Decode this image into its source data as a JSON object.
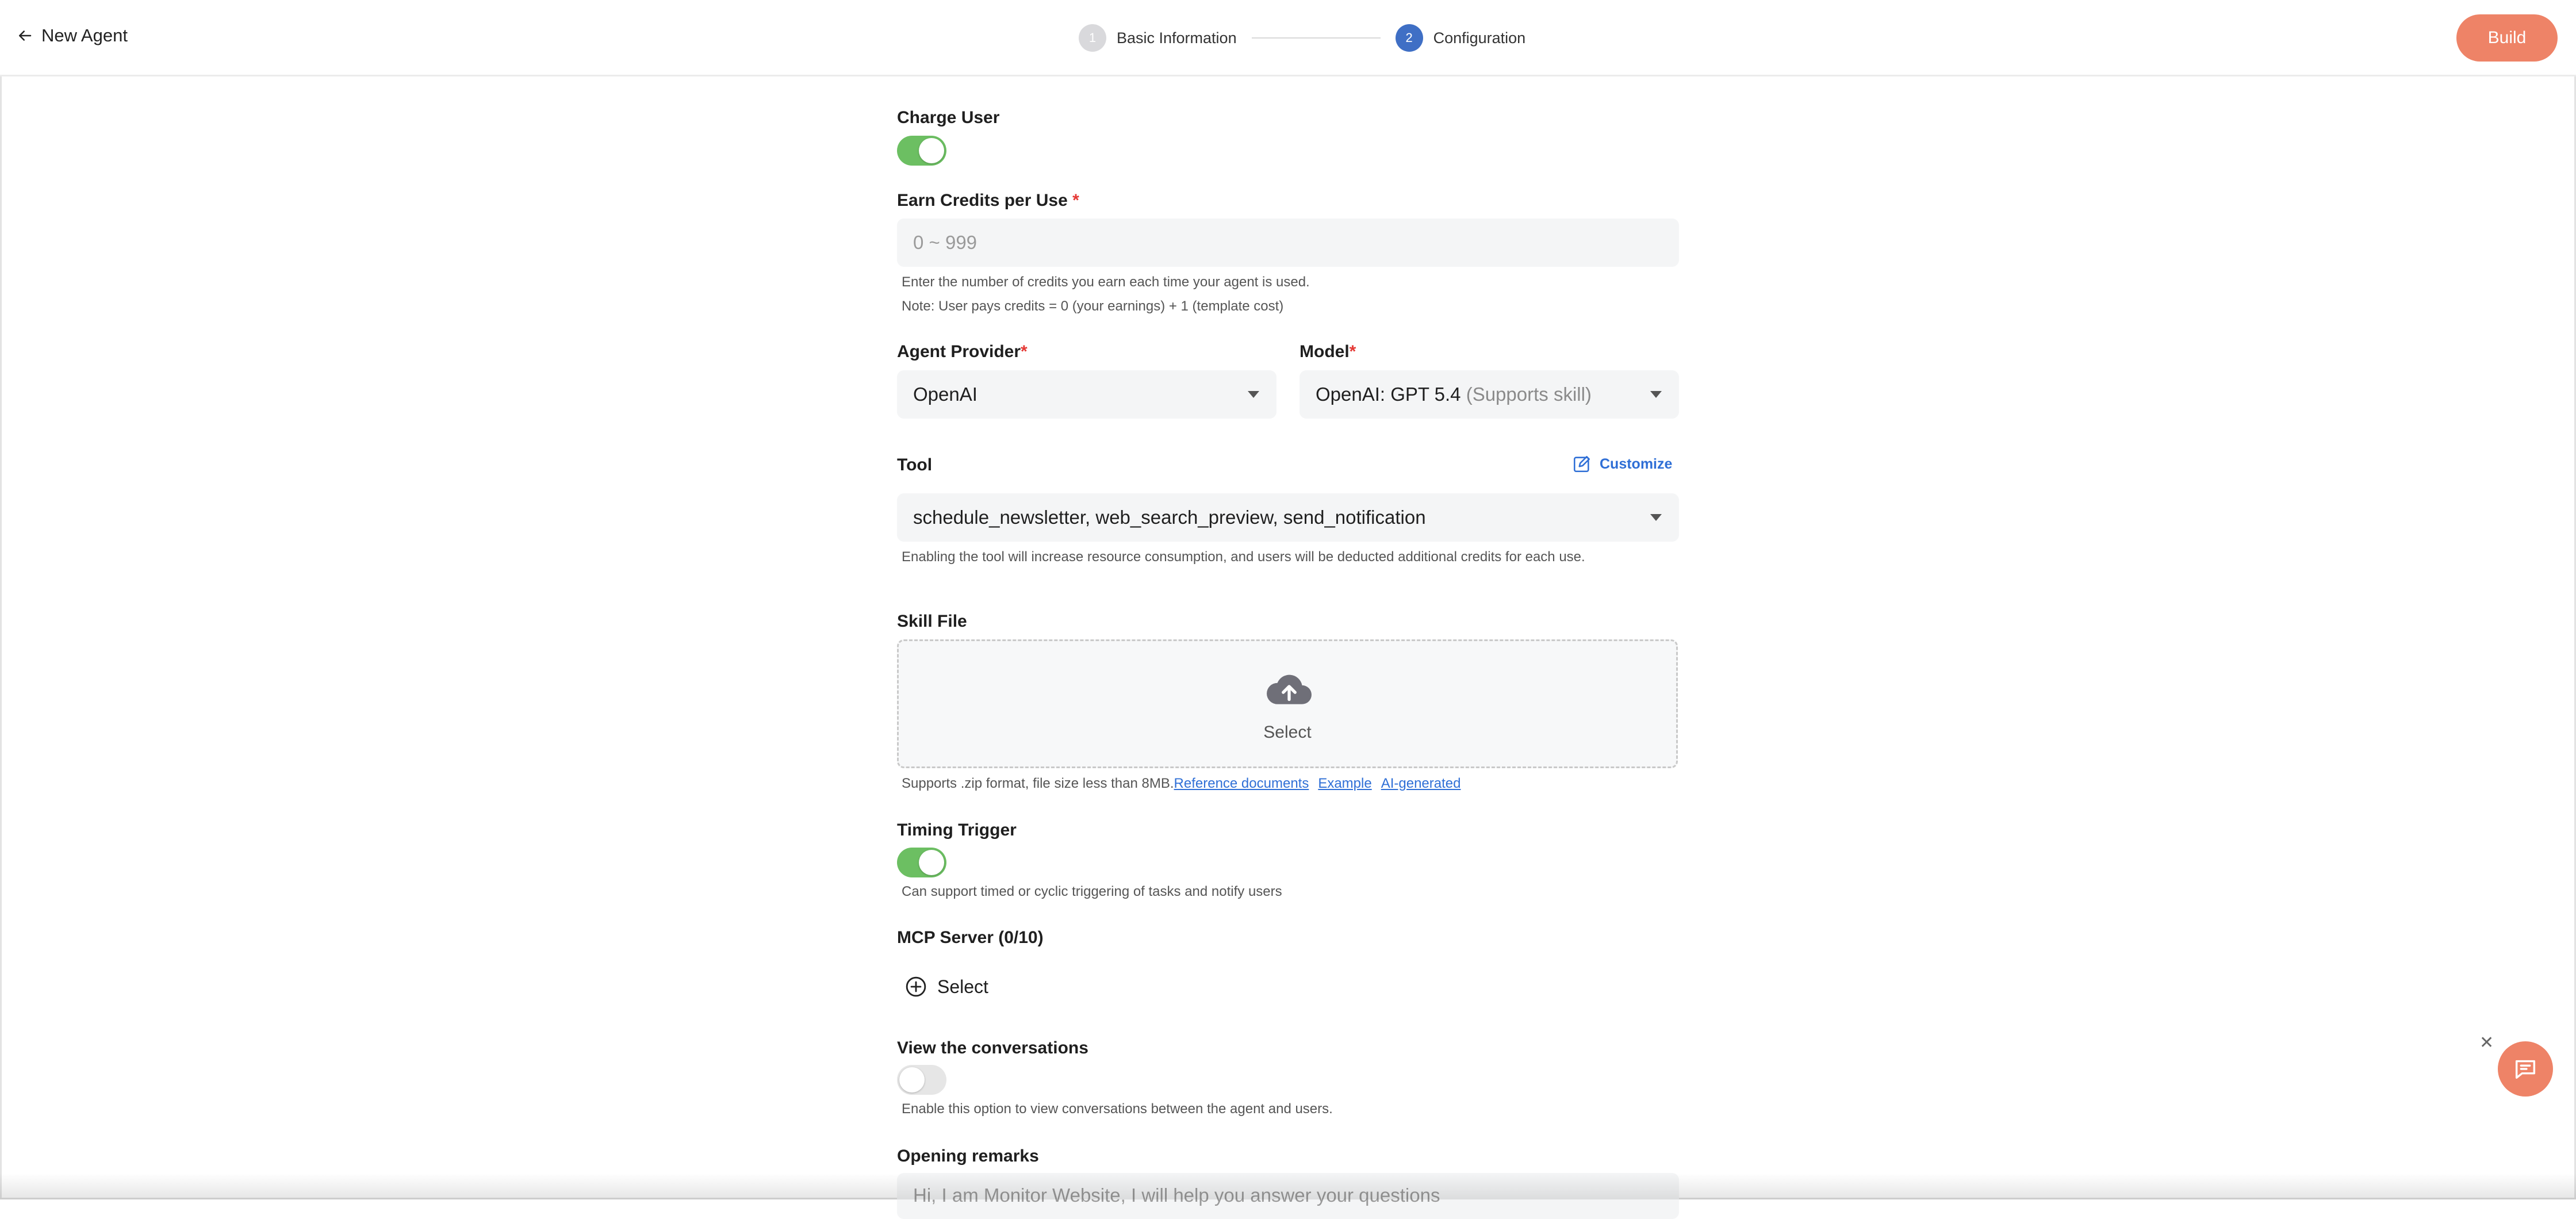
{
  "header": {
    "back_label": "New Agent",
    "steps": [
      {
        "num": "1",
        "label": "Basic Information"
      },
      {
        "num": "2",
        "label": "Configuration"
      }
    ],
    "build_label": "Build"
  },
  "charge_user": {
    "label": "Charge User",
    "enabled": true
  },
  "earn_credits": {
    "label": "Earn Credits per Use",
    "required_mark": "*",
    "placeholder": "0 ~ 999",
    "help1": "Enter the number of credits you earn each time your agent is used.",
    "help2": "Note: User pays credits = 0 (your earnings) + 1 (template cost)"
  },
  "agent_provider": {
    "label": "Agent Provider",
    "required_mark": "*",
    "value": "OpenAI"
  },
  "model": {
    "label": "Model",
    "required_mark": "*",
    "value": "OpenAI: GPT 5.4",
    "note": "(Supports skill)"
  },
  "tool": {
    "label": "Tool",
    "customize_label": "Customize",
    "value": "schedule_newsletter, web_search_preview, send_notification",
    "help": "Enabling the tool will increase resource consumption, and users will be deducted additional credits for each use."
  },
  "skill_file": {
    "label": "Skill File",
    "upload_label": "Select",
    "help": "Supports .zip format, file size less than 8MB.",
    "links": [
      "Reference documents",
      "Example",
      "AI-generated"
    ]
  },
  "timing_trigger": {
    "label": "Timing Trigger",
    "enabled": true,
    "help": "Can support timed or cyclic triggering of tasks and notify users"
  },
  "mcp_server": {
    "label": "MCP Server (0/10)",
    "select_label": "Select"
  },
  "view_conversations": {
    "label": "View the conversations",
    "enabled": false,
    "help": "Enable this option to view conversations between the agent and users."
  },
  "opening_remarks": {
    "label": "Opening remarks",
    "placeholder": "Hi, I am Monitor Website, I will help you answer your questions"
  },
  "colors": {
    "accent": "#ee8367",
    "toggle_on": "#6cbf62",
    "step_active": "#3f6fc5",
    "link": "#2f6fd6"
  }
}
